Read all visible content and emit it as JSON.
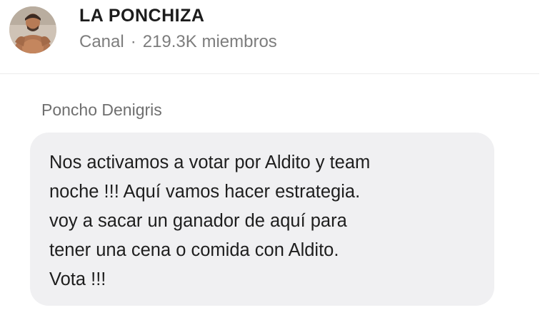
{
  "channel": {
    "name": "LA PONCHIZA",
    "type": "Canal",
    "separator": "·",
    "members": "219.3K miembros",
    "avatar_icon": "profile-photo"
  },
  "message": {
    "sender": "Poncho Denigris",
    "text": "Nos activamos a votar por Aldito y team\nnoche !!! Aquí vamos hacer estrategia.\nvoy a sacar un ganador de aquí para\ntener una cena o comida con Aldito.\nVota !!!"
  },
  "colors": {
    "bubble_background": "#f0f0f2",
    "meta_text": "#7d7d7d",
    "name_text": "#1c1c1c"
  }
}
